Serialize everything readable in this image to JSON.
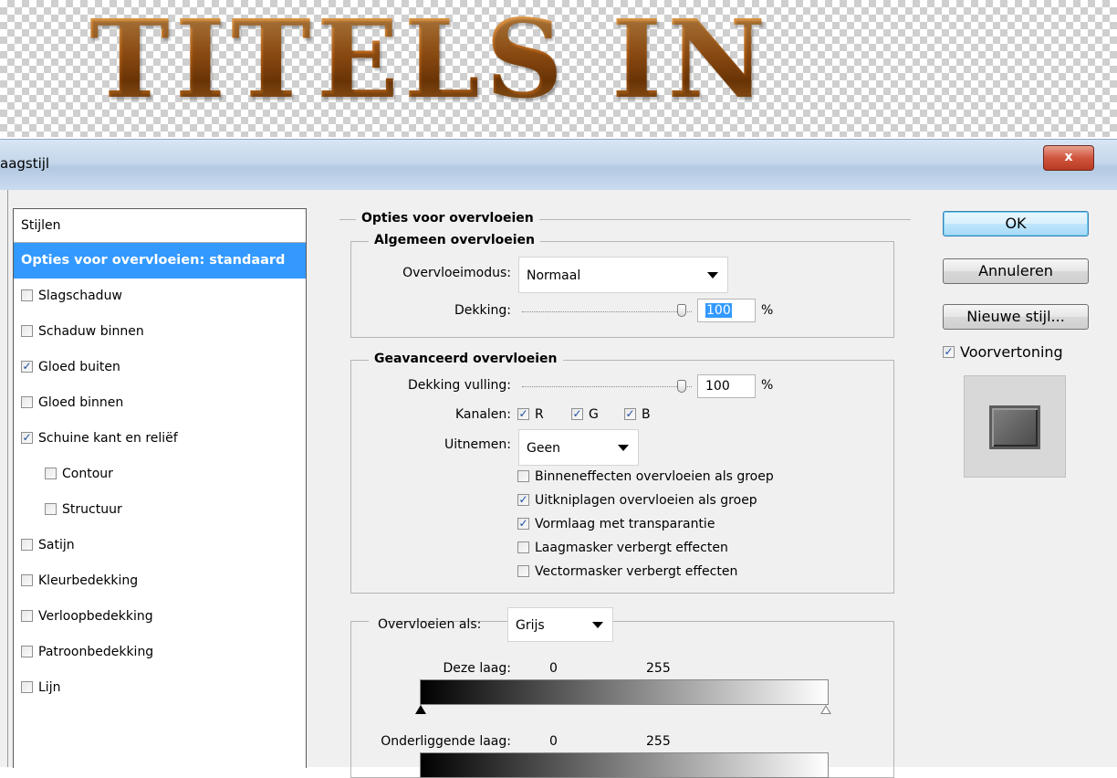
{
  "canvas": {
    "title": "TITELS IN"
  },
  "window": {
    "title": "aagstijl",
    "close_label": "x"
  },
  "styles_panel": {
    "header": "Stijlen",
    "items": [
      {
        "label": "Opties voor overvloeien: standaard",
        "selected": true,
        "checkbox": false,
        "checked": false,
        "indent": false
      },
      {
        "label": "Slagschaduw",
        "checkbox": true,
        "checked": false,
        "indent": false
      },
      {
        "label": "Schaduw binnen",
        "checkbox": true,
        "checked": false,
        "indent": false
      },
      {
        "label": "Gloed buiten",
        "checkbox": true,
        "checked": true,
        "indent": false
      },
      {
        "label": "Gloed binnen",
        "checkbox": true,
        "checked": false,
        "indent": false
      },
      {
        "label": "Schuine kant en reliëf",
        "checkbox": true,
        "checked": true,
        "indent": false
      },
      {
        "label": "Contour",
        "checkbox": true,
        "checked": false,
        "indent": true
      },
      {
        "label": "Structuur",
        "checkbox": true,
        "checked": false,
        "indent": true
      },
      {
        "label": "Satijn",
        "checkbox": true,
        "checked": false,
        "indent": false
      },
      {
        "label": "Kleurbedekking",
        "checkbox": true,
        "checked": false,
        "indent": false
      },
      {
        "label": "Verloopbedekking",
        "checkbox": true,
        "checked": false,
        "indent": false
      },
      {
        "label": "Patroonbedekking",
        "checkbox": true,
        "checked": false,
        "indent": false
      },
      {
        "label": "Lijn",
        "checkbox": true,
        "checked": false,
        "indent": false
      }
    ]
  },
  "blending": {
    "title": "Opties voor overvloeien",
    "general": {
      "title": "Algemeen overvloeien",
      "mode_label": "Overvloeimodus:",
      "mode_value": "Normaal",
      "opacity_label": "Dekking:",
      "opacity_value": "100",
      "opacity_unit": "%"
    },
    "advanced": {
      "title": "Geavanceerd overvloeien",
      "fill_label": "Dekking vulling:",
      "fill_value": "100",
      "fill_unit": "%",
      "channels_label": "Kanalen:",
      "channel_r": "R",
      "channel_g": "G",
      "channel_b": "B",
      "knockout_label": "Uitnemen:",
      "knockout_value": "Geen",
      "options": [
        {
          "label": "Binneneffecten overvloeien als groep",
          "checked": false
        },
        {
          "label": "Uitkniplagen overvloeien als groep",
          "checked": true
        },
        {
          "label": "Vormlaag met transparantie",
          "checked": true
        },
        {
          "label": "Laagmasker verbergt effecten",
          "checked": false
        },
        {
          "label": "Vectormasker verbergt effecten",
          "checked": false
        }
      ]
    },
    "blend_if": {
      "label": "Overvloeien als:",
      "value": "Grijs",
      "this_layer_label": "Deze laag:",
      "this_layer_min": "0",
      "this_layer_max": "255",
      "underlying_label": "Onderliggende laag:",
      "underlying_min": "0",
      "underlying_max": "255"
    }
  },
  "buttons": {
    "ok": "OK",
    "cancel": "Annuleren",
    "new_style": "Nieuwe stijl...",
    "preview_label": "Voorvertoning",
    "preview_checked": true
  },
  "colors": {
    "selection": "#3399ff",
    "title_text": "#b8661a"
  }
}
